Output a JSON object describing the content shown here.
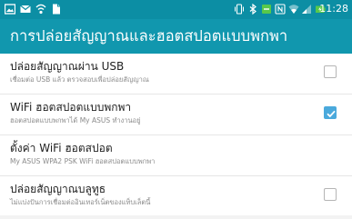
{
  "status_bar": {
    "time": "11:28",
    "background": "#0c8ea4",
    "left_icons": [
      "gallery-icon",
      "email-icon",
      "wifi-hotspot-icon",
      "file-icon"
    ],
    "right_icons": [
      "vibrate-icon",
      "bluetooth-icon",
      "battery-saver-icon",
      "nfc-icon",
      "wifi-signal-icon",
      "cell-signal-icon",
      "battery-charging-icon"
    ]
  },
  "action_bar": {
    "title": "การปล่อยสัญญาณและฮอตสปอตแบบพกพา",
    "background": "#1197ae"
  },
  "settings": [
    {
      "title": "ปล่อยสัญญาณผ่าน USB",
      "summary": "เชื่อมต่อ USB แล้ว ตรวจสอบเพื่อปล่อยสัญญาณ",
      "has_checkbox": true,
      "checked": false
    },
    {
      "title": "WiFi ฮอตสปอตแบบพกพา",
      "summary": "ฮอตสปอตแบบพกพาได้ My ASUS ทำงานอยู่",
      "has_checkbox": true,
      "checked": true
    },
    {
      "title": "ตั้งค่า WiFi ฮอตสปอต",
      "summary": "My ASUS WPA2 PSK WiFi ฮอตสปอตแบบพกพา",
      "has_checkbox": false
    },
    {
      "title": "ปล่อยสัญญาณบลูทูธ",
      "summary": "ไม่แบ่งปันการเชื่อมต่ออินเทอร์เน็ตของแท็บเล็ตนี้",
      "has_checkbox": true,
      "checked": false
    }
  ],
  "colors": {
    "checkbox_checked": "#4aa9dc",
    "checkbox_unchecked_border": "#b5b5b5",
    "text_primary": "#222222",
    "text_secondary": "#8a8a8a"
  }
}
